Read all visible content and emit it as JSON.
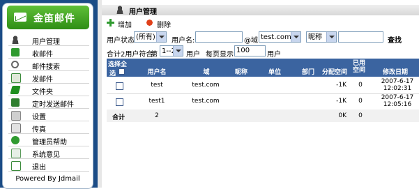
{
  "sidebar": {
    "brand": "金笛邮件",
    "items": [
      {
        "label": "用户管理",
        "icon": "user-icon",
        "color": "#4a4a4a"
      },
      {
        "label": "收邮件",
        "icon": "inbox-icon",
        "color": "#2f9a2f"
      },
      {
        "label": "邮件搜索",
        "icon": "search-icon",
        "color": "#6f6f6f"
      },
      {
        "label": "发邮件",
        "icon": "compose-icon",
        "color": "#3a8a3a"
      },
      {
        "label": "文件夹",
        "icon": "folder-icon",
        "color": "#1f8f1f"
      },
      {
        "label": "定时发送邮件",
        "icon": "schedule-icon",
        "color": "#2f7f2f"
      },
      {
        "label": "设置",
        "icon": "settings-icon",
        "color": "#8a8a8a"
      },
      {
        "label": "传真",
        "icon": "fax-icon",
        "color": "#7a7a7a"
      },
      {
        "label": "管理员帮助",
        "icon": "help-icon",
        "color": "#2f9a2f"
      },
      {
        "label": "系统意见",
        "icon": "feedback-icon",
        "color": "#5a9a5a"
      },
      {
        "label": "退出",
        "icon": "logout-icon",
        "color": "#3a8a3a"
      }
    ],
    "footer": "Powered By Jdmail"
  },
  "main": {
    "title": "用户管理",
    "toolbar": {
      "add": "增加",
      "delete": "删除"
    },
    "filter": {
      "status_label": "用户状态:",
      "status_value": "(所有)",
      "username_label": "用户名:",
      "username_value": "",
      "at_domain": "@域:",
      "domain_value": "test.com",
      "nickname_select": "昵称",
      "nickname_value": "",
      "search": "查找"
    },
    "paging": {
      "summary": "合计2用户符合",
      "page_label": "第",
      "page_value": "1--2",
      "user_unit": "用户",
      "per_page_label": "每页显示",
      "per_page_value": "100",
      "per_page_unit": "用户"
    },
    "table": {
      "select_all": "选择全",
      "headers": [
        "选",
        "用户名",
        "域",
        "昵称",
        "单位",
        "部门",
        "分配空间",
        "已用空间",
        "修改日期"
      ],
      "rows": [
        {
          "user": "test",
          "domain": "test.com",
          "nickname": "",
          "unit": "",
          "dept": "",
          "alloc": "-1K",
          "used": "0",
          "date": "2007-6-17",
          "time": "12:02:31"
        },
        {
          "user": "test1",
          "domain": "test.com",
          "nickname": "",
          "unit": "",
          "dept": "",
          "alloc": "-1K",
          "used": "0",
          "date": "2007-6-17",
          "time": "12:05:16"
        }
      ],
      "total": {
        "label": "合计",
        "count": "2",
        "alloc": "0K",
        "used": "0"
      }
    }
  },
  "colors": {
    "sidebar_bg": "#1b4c86",
    "brand_green": "#2f8e16",
    "table_header": "#3b64a0"
  }
}
